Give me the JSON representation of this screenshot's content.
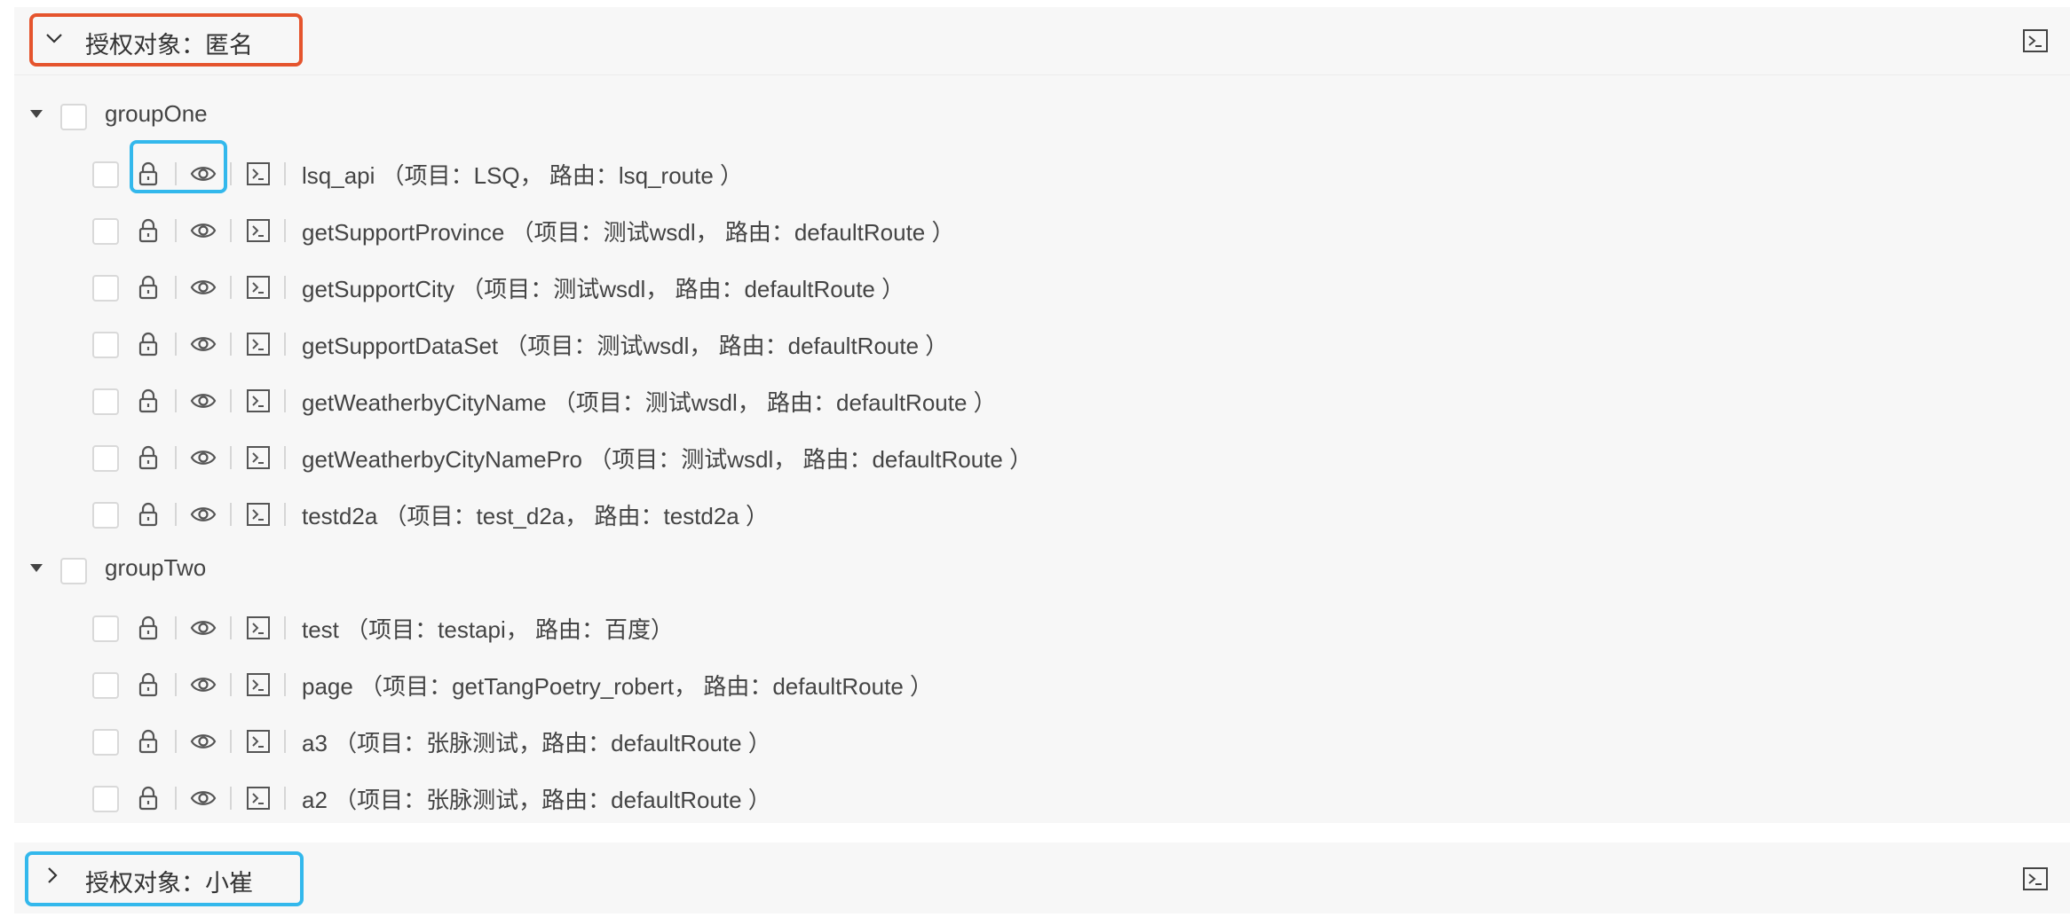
{
  "colors": {
    "highlight_red": "#e5542d",
    "highlight_blue": "#33b8ec",
    "panel_bg": "#f7f7f7",
    "icon": "#555555"
  },
  "icons": {
    "collapse": "chevron-down-icon",
    "expand": "chevron-right-icon",
    "lock": "lock-icon",
    "eye": "eye-icon",
    "terminal": "terminal-icon"
  },
  "panel1": {
    "title": "授权对象：匿名",
    "groups": [
      {
        "label": "groupOne",
        "items": [
          {
            "label": "lsq_api （项目：LSQ， 路由：lsq_route ）"
          },
          {
            "label": "getSupportProvince （项目：测试wsdl， 路由：defaultRoute ）"
          },
          {
            "label": "getSupportCity （项目：测试wsdl， 路由：defaultRoute ）"
          },
          {
            "label": "getSupportDataSet （项目：测试wsdl， 路由：defaultRoute ）"
          },
          {
            "label": "getWeatherbyCityName （项目：测试wsdl， 路由：defaultRoute ）"
          },
          {
            "label": "getWeatherbyCityNamePro （项目：测试wsdl， 路由：defaultRoute ）"
          },
          {
            "label": "testd2a （项目：test_d2a， 路由：testd2a ）"
          }
        ]
      },
      {
        "label": "groupTwo",
        "items": [
          {
            "label": "test （项目：testapi， 路由：百度）"
          },
          {
            "label": "page （项目：getTangPoetry_robert， 路由：defaultRoute ）"
          },
          {
            "label": "a3 （项目：张脉测试，路由：defaultRoute ）"
          },
          {
            "label": "a2 （项目：张脉测试，路由：defaultRoute ）"
          }
        ]
      }
    ]
  },
  "panel2": {
    "title": "授权对象：小崔"
  }
}
